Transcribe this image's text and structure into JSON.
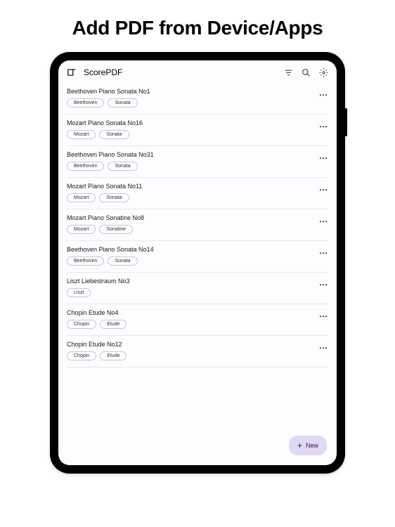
{
  "page_heading": "Add PDF from Device/Apps",
  "app": {
    "name": "ScorePDF"
  },
  "items": [
    {
      "title": "Beethoven Piano Sonata No1",
      "tags": [
        "Beethoven",
        "Sonata"
      ]
    },
    {
      "title": "Mozart Piano Sonata No16",
      "tags": [
        "Mozart",
        "Sonata"
      ]
    },
    {
      "title": "Beethoven Piano Sonata No31",
      "tags": [
        "Beethoven",
        "Sonata"
      ]
    },
    {
      "title": "Mozart Piano Sonata No11",
      "tags": [
        "Mozart",
        "Sonata"
      ]
    },
    {
      "title": "Mozart Piano Sonatine No8",
      "tags": [
        "Mozart",
        "Sonatine"
      ]
    },
    {
      "title": "Beethoven Piano Sonata No14",
      "tags": [
        "Beethoven",
        "Sonata"
      ]
    },
    {
      "title": "Liszt Liebestraum No3",
      "tags": [
        "Liszt"
      ]
    },
    {
      "title": "Chopin Etude No4",
      "tags": [
        "Chopin",
        "Etude"
      ]
    },
    {
      "title": "Chopin Etude No12",
      "tags": [
        "Chopin",
        "Etude"
      ]
    }
  ],
  "fab": {
    "label": "New"
  }
}
